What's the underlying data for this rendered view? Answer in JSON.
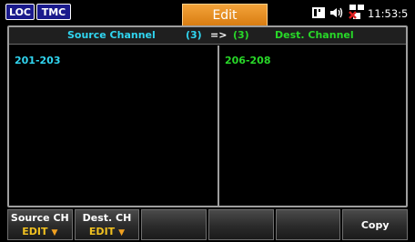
{
  "status_bar": {
    "loc_badge": "LOC",
    "tmc_badge": "TMC",
    "mode_title": "Edit",
    "time": "11:53:5"
  },
  "table": {
    "source_header": "Source Channel",
    "source_count": "(3)",
    "arrow": "=>",
    "dest_count": "(3)",
    "dest_header": "Dest. Channel",
    "source_channels": "201-203",
    "dest_channels": "206-208"
  },
  "softkeys": {
    "source_ch_label": "Source CH",
    "source_ch_sub": "EDIT",
    "dest_ch_label": "Dest. CH",
    "dest_ch_sub": "EDIT",
    "copy_label": "Copy"
  },
  "colors": {
    "source": "#30d5f0",
    "dest": "#28d828",
    "title_tab": "#e88d1e",
    "badge": "#1a1a8c"
  },
  "icons": [
    "sd-card-icon",
    "speaker-icon",
    "network-icon"
  ]
}
